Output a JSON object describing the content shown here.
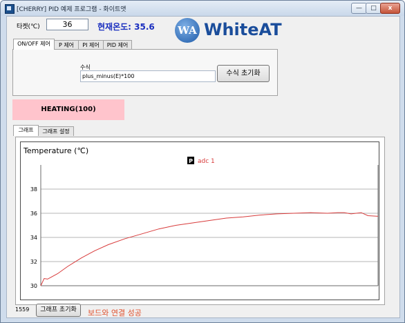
{
  "window": {
    "title": "[CHERRY] PID 예제 프로그램 - 화이트앳",
    "controls": {
      "minimize": "—",
      "maximize": "□",
      "close": "x"
    }
  },
  "header": {
    "target_label": "타켓(℃)",
    "target_value": "36",
    "current_temp": "현재온도: 35.6",
    "logo_badge": "WA",
    "logo_text": "WhiteAT"
  },
  "control_tabs": [
    {
      "label": "ON/OFF 제어"
    },
    {
      "label": "P 제어"
    },
    {
      "label": "PI 제어"
    },
    {
      "label": "PID 제어"
    }
  ],
  "formula": {
    "label": "수식",
    "value": "plus_minus(E)*100",
    "reset_button": "수식 초기화"
  },
  "status_banner": "HEATING(100)",
  "graph_tabs": [
    {
      "label": "그래프"
    },
    {
      "label": "그래프 설정"
    }
  ],
  "chart_data": {
    "type": "line",
    "title": "Temperature (℃)",
    "legend": [
      {
        "badge": "P",
        "name": "adc 1"
      }
    ],
    "legend_placement": "top-center",
    "grid": true,
    "ylim": [
      30,
      40
    ],
    "yticks": [
      30,
      32,
      34,
      36,
      38
    ],
    "series": [
      {
        "name": "adc 1",
        "color": "#d83a3a",
        "x": [
          0,
          1,
          2,
          3,
          5,
          8,
          12,
          16,
          20,
          25,
          30,
          35,
          40,
          45,
          50,
          55,
          60,
          65,
          70,
          75,
          80,
          85,
          88,
          90,
          92,
          95,
          97,
          100
        ],
        "y": [
          30.0,
          30.6,
          30.55,
          30.7,
          31.0,
          31.6,
          32.3,
          32.9,
          33.4,
          33.9,
          34.3,
          34.7,
          35.0,
          35.2,
          35.4,
          35.6,
          35.7,
          35.85,
          35.95,
          36.0,
          36.05,
          36.0,
          36.05,
          36.05,
          35.95,
          36.05,
          35.8,
          35.75
        ]
      }
    ]
  },
  "footer": {
    "count": "1559",
    "reset_graph_button": "그래프 초기화",
    "connection_status": "보드와 연결 성공"
  }
}
